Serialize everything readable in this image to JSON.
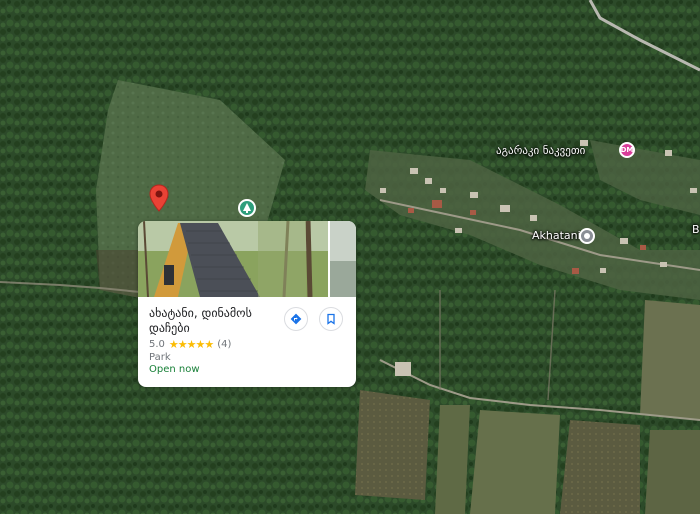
{
  "map": {
    "labels": {
      "village": "აგარაკი ნაკვეთი",
      "village_badge": "DM",
      "akhatani": "Akhatani",
      "edge_letter": "B"
    },
    "icons": {
      "selected_pin": "red-location-pin-icon",
      "park_marker": "tree-icon",
      "village_marker": "lodging-icon",
      "akhatani_marker": "locality-pin-icon"
    },
    "colors": {
      "pin": "#e94235",
      "park_marker": "#2e9e7c",
      "village_marker": "#d93d9a",
      "akhatani_marker": "#8a8f96"
    }
  },
  "card": {
    "title": "ახატანი, დინამოს დაჩები",
    "rating": "5.0",
    "stars": "★★★★★",
    "review_count": "(4)",
    "category": "Park",
    "status": "Open now",
    "status_color": "#188038",
    "buttons": {
      "directions_icon": "directions-icon",
      "save_icon": "bookmark-icon"
    }
  }
}
